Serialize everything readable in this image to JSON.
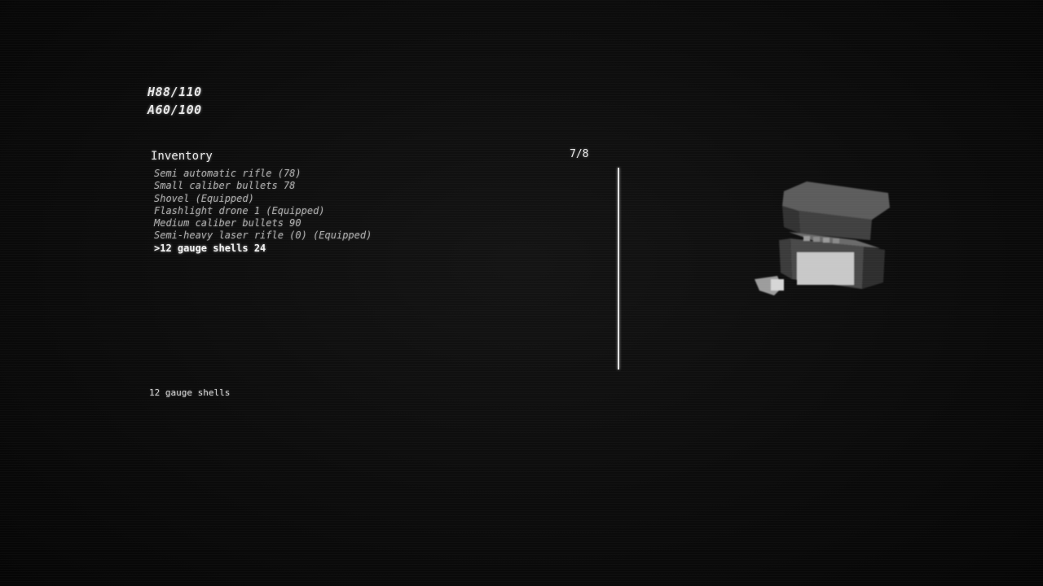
{
  "hud": {
    "health": "H88/110",
    "armor": "A60/100"
  },
  "inventory": {
    "title": "Inventory",
    "count": "7/8",
    "items": [
      "Semi automatic rifle (78)",
      "Small caliber bullets 78",
      "Shovel (Equipped)",
      "Flashlight drone 1 (Equipped)",
      "Medium caliber bullets 90",
      "Semi-heavy laser rifle (0) (Equipped)",
      ">12 gauge shells 24"
    ],
    "selected_index": 6,
    "selected_description": "12 gauge shells"
  },
  "preview": {
    "icon": "ammo-box-icon"
  }
}
